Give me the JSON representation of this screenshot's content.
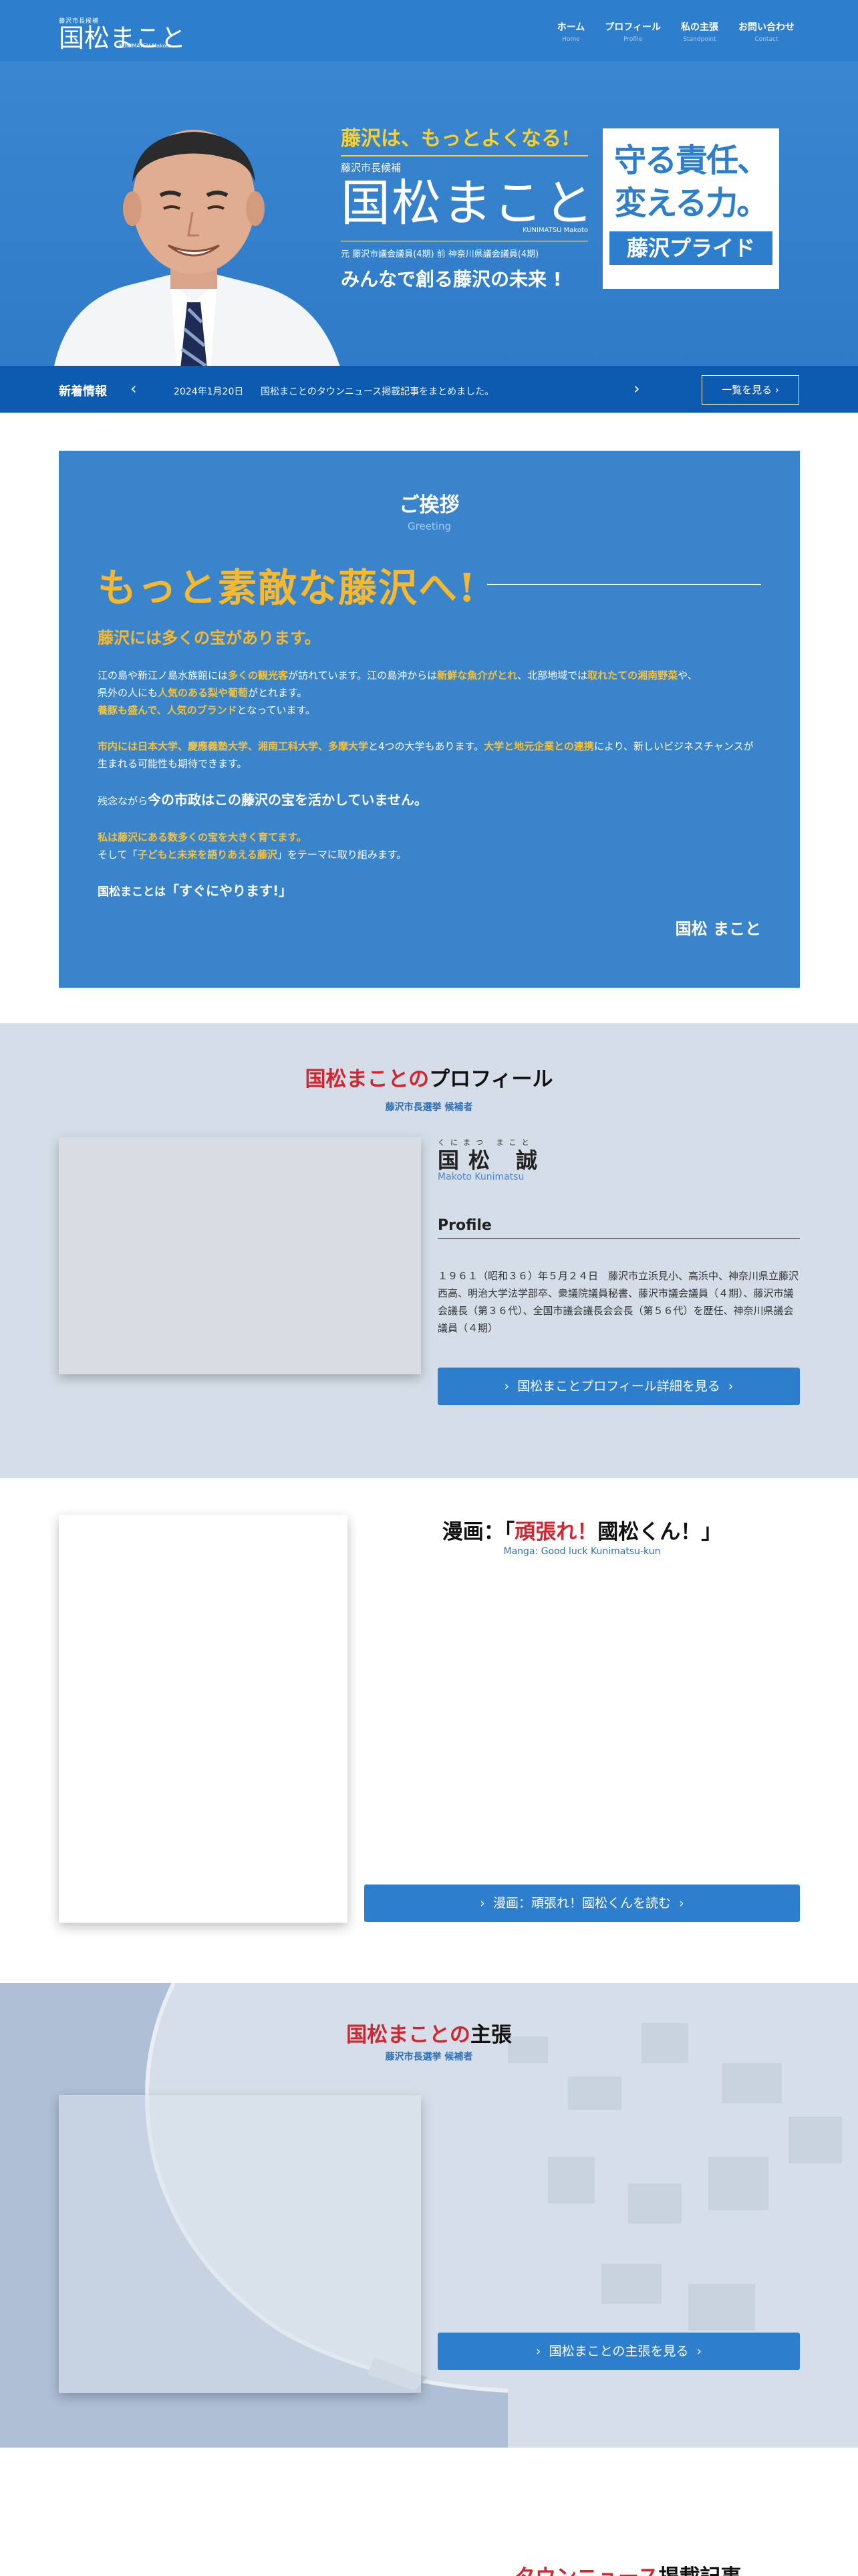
{
  "header": {
    "logo_small": "藤沢市長候補",
    "logo_name": "国松まこと",
    "logo_roman": "KUNIMATSU Makoto",
    "nav": [
      {
        "jp": "ホーム",
        "en": "Home"
      },
      {
        "jp": "プロフィール",
        "en": "Profile"
      },
      {
        "jp": "私の主張",
        "en": "Standpoint"
      },
      {
        "jp": "お問い合わせ",
        "en": "Contact"
      }
    ]
  },
  "hero": {
    "catch": "藤沢は、もっとよくなる!",
    "candidate": "藤沢市長候補",
    "name": "国松まこと",
    "roman": "KUNIMATSU Makoto",
    "career": "元 藤沢市議会議員(4期) 前 神奈川県議会議員(4期)",
    "slogan": "みんなで創る藤沢の未来 !",
    "box_line1": "守る責任、",
    "box_line2": "変える力。",
    "box_pride": "藤沢プライド"
  },
  "news": {
    "label": "新着情報",
    "prev_icon": "chevron-left-icon",
    "next_icon": "chevron-right-icon",
    "date": "2024年1月20日",
    "title": "国松まことのタウンニュース掲載記事をまとめました。",
    "button": "一覧を見る"
  },
  "greeting": {
    "title": "ご挨拶",
    "subtitle": "Greeting",
    "catch": "もっと素敵な藤沢へ!",
    "sub": "藤沢には多くの宝があります。",
    "p1_a": "江の島や新江ノ島水族館には",
    "p1_b": "多くの観光客",
    "p1_c": "が訪れています。江の島沖からは",
    "p1_d": "新鮮な魚介がとれ",
    "p1_e": "、北部地域では",
    "p1_f": "取れたての湘南野菜",
    "p1_g": "や、",
    "p1_h": "県外の人にも",
    "p1_i": "人気のある梨や葡萄",
    "p1_j": "がとれます。",
    "p1_k": "養豚も盛んで、人気のブランド",
    "p1_l": "となっています。",
    "p2_a": "市内には日本大学、慶應義塾大学、湘南工科大学、多摩大学",
    "p2_b": "と4つの大学もあります。",
    "p2_c": "大学と地元企業との連携",
    "p2_d": "により、新しいビジネスチャンスが生まれる可能性も期待できます。",
    "p3_a": "残念ながら",
    "p3_b": "今の市政はこの藤沢の宝を活かしていません。",
    "p4_a": "私は藤沢にある数多くの宝を大きく育てます。",
    "p4_b": "そして「",
    "p4_c": "子どもと未来を語りあえる藤沢",
    "p4_d": "」をテーマに取り組みます。",
    "p5_a": "国松まことは",
    "p5_b": "「すぐにやります!」",
    "sign": "国松 まこと"
  },
  "profile": {
    "title_red": "国松まことの",
    "title_black": "プロフィール",
    "subtitle": "藤沢市長選挙 候補者",
    "ruby": "くにまつ まこと",
    "name": "国松 誠",
    "roman": "Makoto Kunimatsu",
    "heading": "Profile",
    "body": "１９６１（昭和３６）年５月２４日　藤沢市立浜見小、高浜中、神奈川県立藤沢西高、明治大学法学部卒、衆議院議員秘書、藤沢市議会議員（４期）、藤沢市議会議長（第３６代）、全国市議会議長会会長（第５６代）を歴任、神奈川県議会議員（４期）",
    "button": "国松まことプロフィール詳細を見る"
  },
  "manga": {
    "title_a": "漫画：「",
    "title_red": "頑張れ！",
    "title_b": "國松くん！」",
    "subtitle": "Manga: Good luck Kunimatsu-kun",
    "button": "漫画：頑張れ！國松くんを読む"
  },
  "claims": {
    "title_red": "国松まことの",
    "title_black": "主張",
    "subtitle": "藤沢市長選挙 候補者",
    "button": "国松まことの主張を見る"
  },
  "town": {
    "title_red": "タウンニュース",
    "title_black": "掲載記事"
  },
  "colors": {
    "primary": "#2d7fce",
    "dark_blue": "#0d5bb0",
    "accent_yellow": "#f5b82e",
    "accent_red": "#d0262f"
  }
}
